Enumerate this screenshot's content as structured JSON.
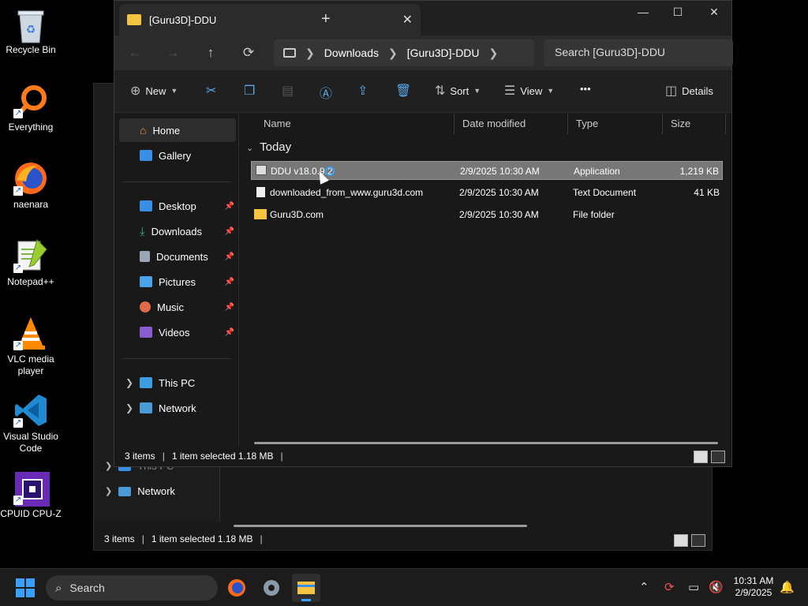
{
  "desktop": {
    "icons": [
      {
        "label": "Recycle Bin",
        "icon": "recycle-bin-icon"
      },
      {
        "label": "Everything",
        "icon": "everything-search-icon"
      },
      {
        "label": "naenara",
        "icon": "firefox-icon"
      },
      {
        "label": "Notepad++",
        "icon": "notepad-plus-plus-icon"
      },
      {
        "label": "VLC media player",
        "icon": "vlc-icon"
      },
      {
        "label": "Visual Studio Code",
        "icon": "vscode-icon"
      },
      {
        "label": "CPUID CPU-Z",
        "icon": "cpuz-icon"
      }
    ]
  },
  "back_window": {
    "nav": {
      "this_pc": "This PC",
      "network": "Network"
    },
    "status": {
      "items": "3 items",
      "selected": "1 item selected  1.18 MB"
    }
  },
  "window": {
    "tab_title": "[Guru3D]-DDU",
    "new_tab": "+",
    "controls": {
      "minimize": "—",
      "maximize": "☐",
      "close": "✕"
    },
    "breadcrumb": [
      "Downloads",
      "[Guru3D]-DDU"
    ],
    "search_placeholder": "Search [Guru3D]-DDU",
    "toolbar": {
      "new": "New",
      "sort": "Sort",
      "view": "View",
      "more": "•••",
      "details": "Details"
    },
    "sidebar": {
      "home": "Home",
      "gallery": "Gallery",
      "quick": [
        {
          "label": "Desktop",
          "color": "#3a8ee6"
        },
        {
          "label": "Downloads",
          "color": "#3ab07a"
        },
        {
          "label": "Documents",
          "color": "#9aa5b5"
        },
        {
          "label": "Pictures",
          "color": "#4aa3e8"
        },
        {
          "label": "Music",
          "color": "#e06a4a"
        },
        {
          "label": "Videos",
          "color": "#8a5cd0"
        }
      ],
      "this_pc": "This PC",
      "network": "Network"
    },
    "columns": {
      "name": "Name",
      "date": "Date modified",
      "type": "Type",
      "size": "Size"
    },
    "group": "Today",
    "files": [
      {
        "name": "DDU v18.0.9.2",
        "date": "2/9/2025 10:30 AM",
        "type": "Application",
        "size": "1,219 KB"
      },
      {
        "name": "downloaded_from_www.guru3d.com",
        "date": "2/9/2025 10:30 AM",
        "type": "Text Document",
        "size": "41 KB"
      },
      {
        "name": "Guru3D.com",
        "date": "2/9/2025 10:30 AM",
        "type": "File folder",
        "size": ""
      }
    ],
    "status": {
      "items": "3 items",
      "selected": "1 item selected  1.18 MB"
    }
  },
  "taskbar": {
    "search": "Search",
    "time": "10:31 AM",
    "date": "2/9/2025"
  }
}
